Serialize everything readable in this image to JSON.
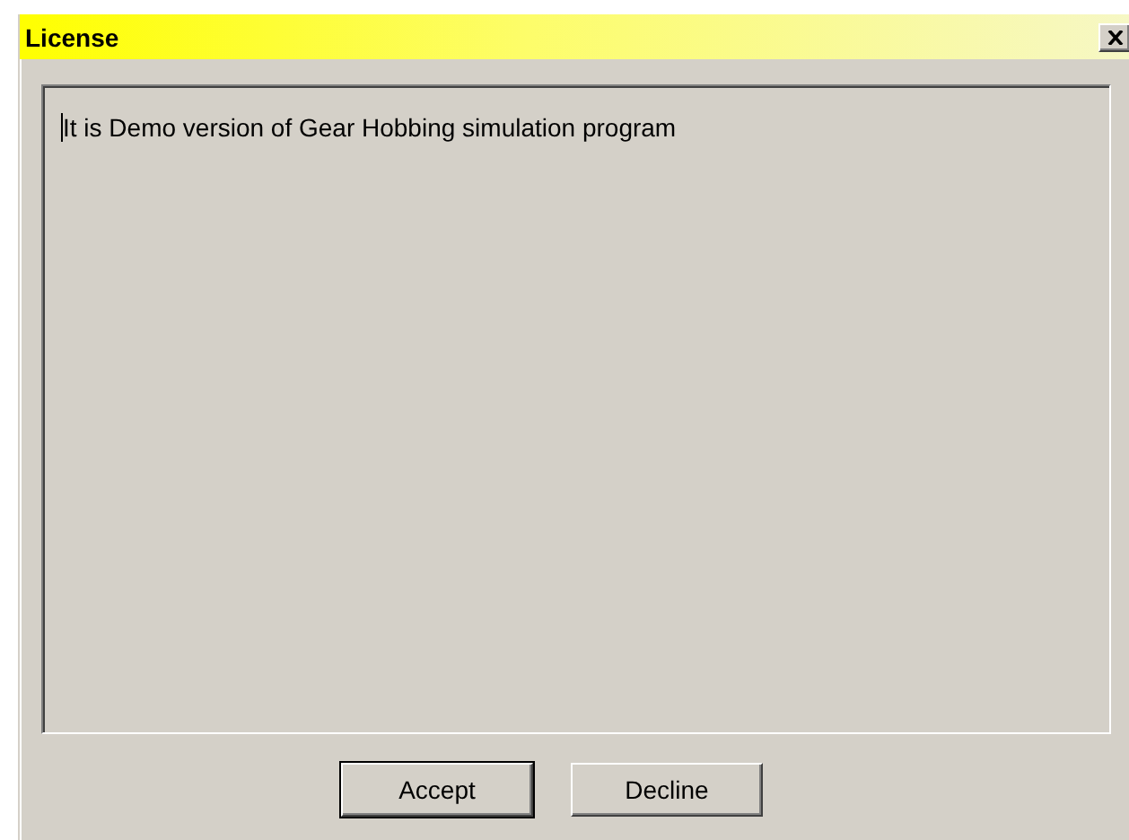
{
  "window": {
    "title": "License"
  },
  "text_area": {
    "value": "It is Demo version of Gear Hobbing simulation program"
  },
  "buttons": [
    {
      "label": "Accept",
      "default": true
    },
    {
      "label": "Decline",
      "default": false
    }
  ]
}
